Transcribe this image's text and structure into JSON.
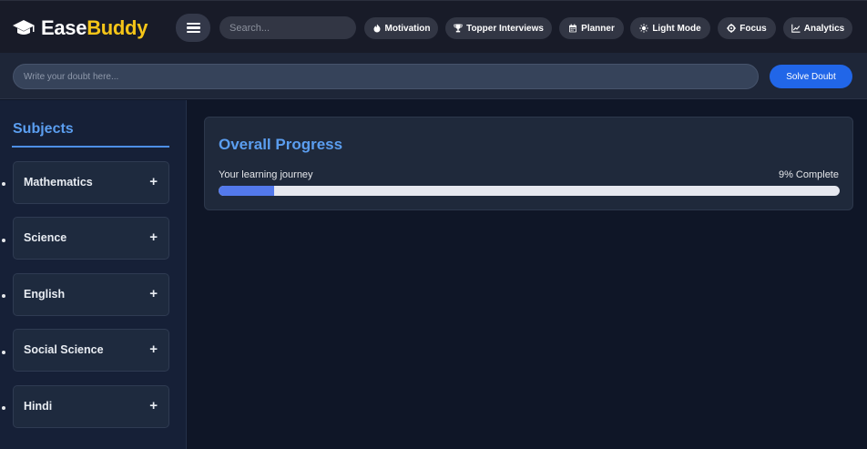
{
  "app": {
    "brand_part1": "Ease",
    "brand_part2": "Buddy",
    "brand_icon": "graduation-cap-icon"
  },
  "header": {
    "search_placeholder": "Search...",
    "menu_icon": "hamburger-menu-icon",
    "nav": [
      {
        "label": "Motivation",
        "icon": "fire-icon"
      },
      {
        "label": "Topper Interviews",
        "icon": "trophy-icon"
      },
      {
        "label": "Planner",
        "icon": "calendar-icon"
      },
      {
        "label": "Light Mode",
        "icon": "sun-icon"
      },
      {
        "label": "Focus",
        "icon": "crosshair-icon"
      },
      {
        "label": "Analytics",
        "icon": "chart-line-icon"
      }
    ]
  },
  "doubt": {
    "placeholder": "Write your doubt here...",
    "button_label": "Solve Doubt"
  },
  "sidebar": {
    "title": "Subjects",
    "subjects": [
      {
        "label": "Mathematics",
        "toggle": "+"
      },
      {
        "label": "Science",
        "toggle": "+"
      },
      {
        "label": "English",
        "toggle": "+"
      },
      {
        "label": "Social Science",
        "toggle": "+"
      },
      {
        "label": "Hindi",
        "toggle": "+"
      }
    ]
  },
  "progress": {
    "title": "Overall Progress",
    "subtitle": "Your learning journey",
    "percent_text": "9% Complete",
    "percent_value": 9
  },
  "colors": {
    "accent": "#2166e8",
    "title_blue": "#5b9ef0",
    "brand_yellow": "#f5c518",
    "progress_fill": "#5379ec"
  }
}
